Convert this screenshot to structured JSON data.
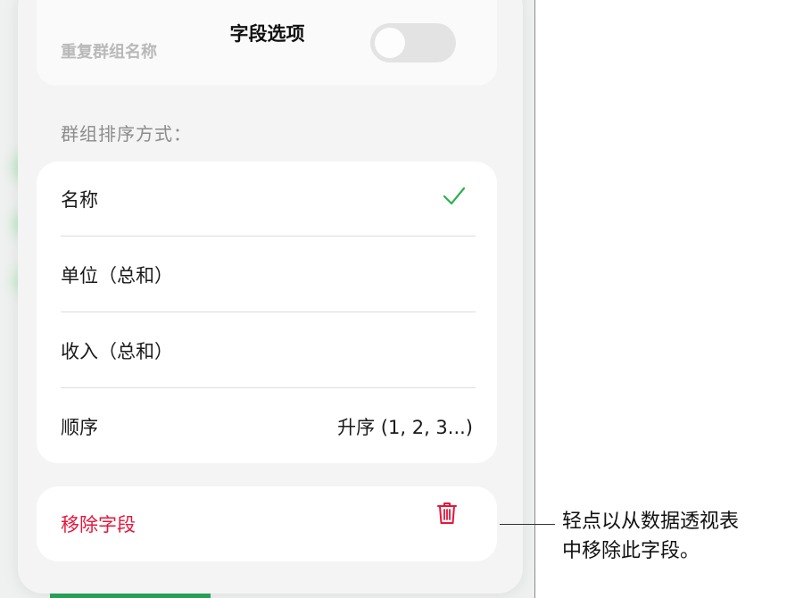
{
  "sheet": {
    "title": "字段选项",
    "repeat_group_names_label": "重复群组名称",
    "sort_section_header": "群组排序方式：",
    "options": [
      {
        "label": "名称",
        "value": "",
        "checked": true
      },
      {
        "label": "单位（总和）",
        "value": ""
      },
      {
        "label": "收入（总和）",
        "value": ""
      },
      {
        "label": "顺序",
        "value": "升序 (1, 2, 3...)"
      }
    ],
    "remove_label": "移除字段",
    "check_icon": "checkmark-icon",
    "trash_icon": "trash-icon"
  },
  "callout": {
    "line1": "轻点以从数据透视表",
    "line2": "中移除此字段。"
  },
  "colors": {
    "accent_green": "#2bb14f",
    "destructive_red": "#e4163a"
  }
}
